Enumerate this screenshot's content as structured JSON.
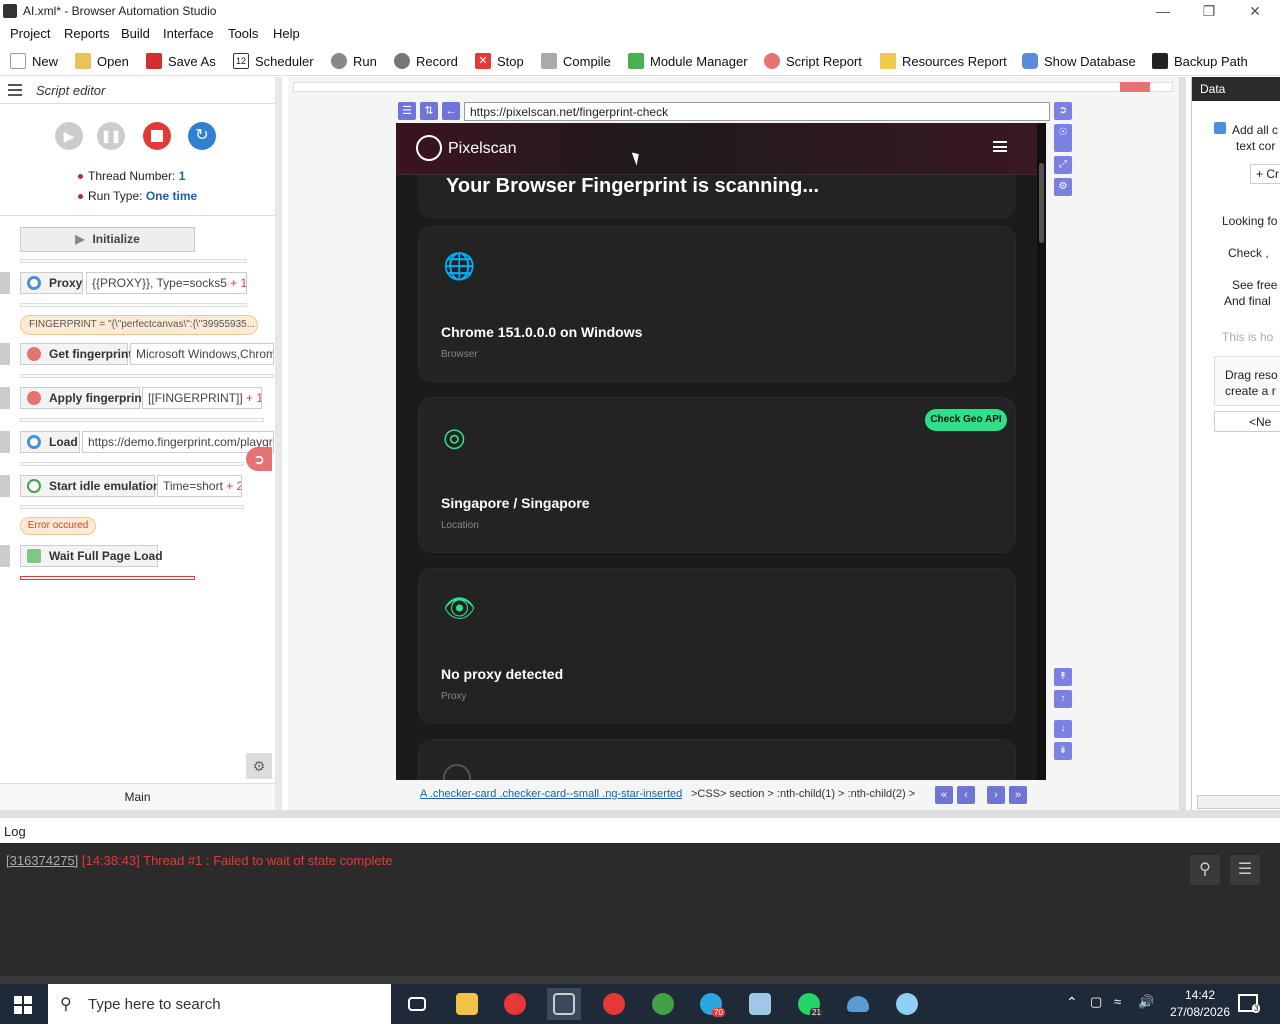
{
  "window": {
    "title": "AI.xml* - Browser Automation Studio"
  },
  "menu": [
    "Project",
    "Reports",
    "Build",
    "Interface",
    "Tools",
    "Help"
  ],
  "toolbar": [
    "New",
    "Open",
    "Save As",
    "Scheduler",
    "Run",
    "Record",
    "Stop",
    "Compile",
    "Module Manager",
    "Script Report",
    "Resources Report",
    "Show Database",
    "Backup Path"
  ],
  "scheduler_icon_text": "12",
  "editor": {
    "title": "Script editor",
    "thread_label": "Thread Number:",
    "thread_value": "1",
    "runtype_label": "Run Type:",
    "runtype_value": "One time",
    "initialize": "Initialize",
    "actions": [
      {
        "name": "Proxy",
        "param": "{{PROXY}}, Type=socks5",
        "extra": "+ 1"
      },
      {
        "name": "Get fingerprint",
        "param": "Microsoft Windows,Chrome",
        "extra": ""
      },
      {
        "name": "Apply fingerprint",
        "param": "[[FINGERPRINT]]",
        "extra": "+ 1"
      },
      {
        "name": "Load",
        "param": "https://demo.fingerprint.com/playgro",
        "extra": ""
      },
      {
        "name": "Start idle emulation",
        "param": "Time=short",
        "extra": "+ 2"
      },
      {
        "name": "Wait Full Page Load",
        "param": "",
        "extra": ""
      }
    ],
    "fingerprint_tag": "FINGERPRINT = \"{\\\"perfectcanvas\\\":{\\\"39955935...",
    "error_tag": "Error occured",
    "tab": "Main"
  },
  "browser": {
    "url": "https://pixelscan.net/fingerprint-check",
    "brand": "Pixelscan",
    "headline": "Your Browser Fingerprint is scanning...",
    "cards": [
      {
        "title": "Chrome 151.0.0.0 on Windows",
        "sub": "Browser",
        "badge": ""
      },
      {
        "title": "Singapore / Singapore",
        "sub": "Location",
        "badge": "Check Geo API"
      },
      {
        "title": "No proxy detected",
        "sub": "Proxy",
        "badge": ""
      }
    ],
    "selector_link": "A .checker-card .checker-card--small .ng-star-inserted",
    "selector_path": ">CSS> section > :nth-child(1) > :nth-child(2) >"
  },
  "right": {
    "title": "Data",
    "lines": [
      "Add all c",
      "text cor",
      "+ Cr",
      "Looking fo",
      "Check ,",
      "See free",
      "And final",
      "This is ho",
      "Drag reso",
      "create a r",
      "<Ne"
    ]
  },
  "log": {
    "title": "Log",
    "id": "[316374275]",
    "message": "[14:38:43] Thread #1 : Failed to wait of state complete"
  },
  "taskbar": {
    "search": "Type here to search",
    "time": "14:42",
    "date": "27/08/2026",
    "badge_telegram": "70",
    "badge_whatsapp": "21",
    "badge_notif": "3"
  },
  "colors": {
    "accent_green": "#2fe08a",
    "error_red": "#e53935",
    "link_blue": "#1a5fb4"
  }
}
